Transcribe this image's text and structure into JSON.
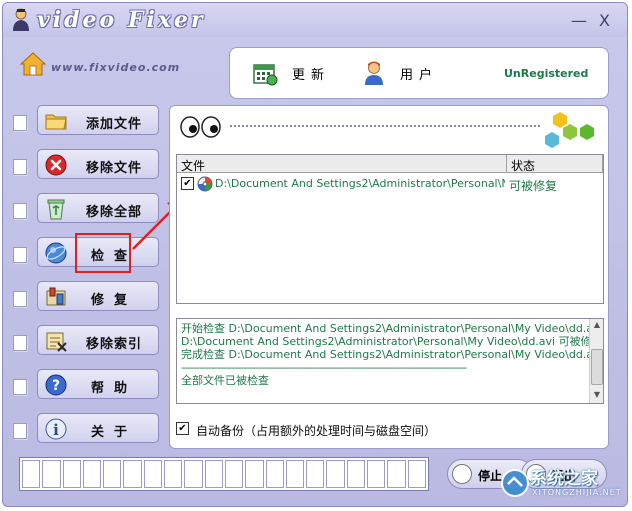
{
  "window": {
    "title": "video Fixer",
    "minimize": "—",
    "close": "X"
  },
  "header": {
    "url": "www.fixvideo.com"
  },
  "toolbar": {
    "update_label": "更新",
    "user_label": "用户",
    "registration": "UnRegistered"
  },
  "sidebar": {
    "items": [
      {
        "label": "添加文件",
        "icon": "folder-icon"
      },
      {
        "label": "移除文件",
        "icon": "remove-red-x-icon"
      },
      {
        "label": "移除全部",
        "icon": "recycle-bin-icon"
      },
      {
        "label": "检查",
        "icon": "globe-check-icon"
      },
      {
        "label": "修复",
        "icon": "repair-tools-icon"
      },
      {
        "label": "移除索引",
        "icon": "remove-index-icon"
      },
      {
        "label": "帮助",
        "icon": "help-icon"
      },
      {
        "label": "关于",
        "icon": "info-icon"
      }
    ]
  },
  "file_list": {
    "columns": [
      "文件",
      "状态"
    ],
    "rows": [
      {
        "checked": true,
        "path": "D:\\Document And Settings2\\Administrator\\Personal\\My Video\\dd.avi",
        "status": "可被修复"
      }
    ]
  },
  "log": {
    "lines": [
      "开始检查 D:\\Document And Settings2\\Administrator\\Personal\\My Video\\dd.avi",
      "D:\\Document And Settings2\\Administrator\\Personal\\My Video\\dd.avi 可被修复",
      "完成检查 D:\\Document And Settings2\\Administrator\\Personal\\My Video\\dd.avi",
      "------------------------------------------------------------------------------------------------",
      "全部文件已被检查"
    ]
  },
  "backup": {
    "checked": true,
    "label": "自动备份（占用额外的处理时间与磁盘空间）"
  },
  "bottom": {
    "stop_label": "停止",
    "exit_label": "退出"
  },
  "watermark": {
    "text": "系统之家",
    "url": "XITONGZHIJIA.NET"
  },
  "colors": {
    "accent_green": "#1f7a4a",
    "window_bg": "#c3c3e8",
    "highlight_red": "#e02020"
  }
}
